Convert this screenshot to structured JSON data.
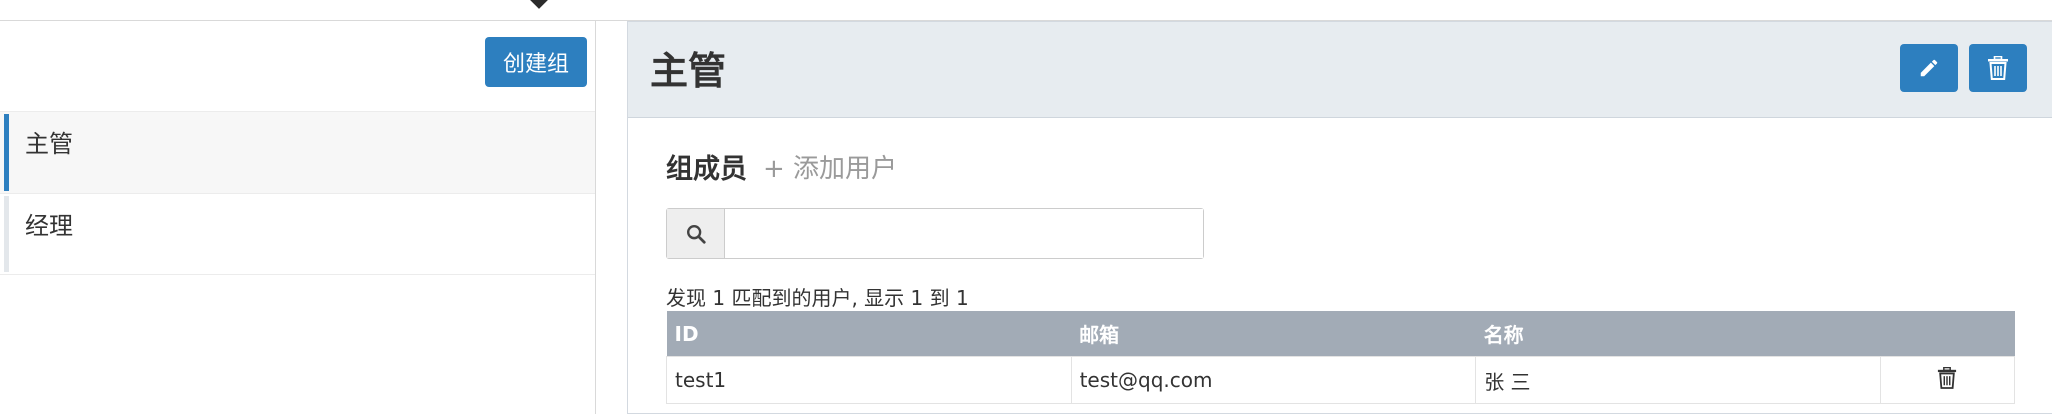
{
  "sidebar": {
    "create_button_label": "创建组",
    "groups": [
      {
        "label": "主管",
        "active": true
      },
      {
        "label": "经理",
        "active": false
      }
    ]
  },
  "main": {
    "title": "主管",
    "members_title": "组成员",
    "add_user_label": "+ 添加用户",
    "search": {
      "value": "",
      "placeholder": ""
    },
    "result_info": "发现 1 匹配到的用户, 显示 1 到 1",
    "table": {
      "columns": [
        "ID",
        "邮箱",
        "名称",
        ""
      ],
      "rows": [
        {
          "id": "test1",
          "email": "test@qq.com",
          "name": "张 三"
        }
      ]
    }
  },
  "icons": {
    "edit": "pencil-icon",
    "delete": "trash-icon",
    "search": "search-icon",
    "row_delete": "trash-icon"
  },
  "colors": {
    "primary": "#2d7fbf",
    "header_bg": "#e7ecf0",
    "table_header_bg": "#a2abb6",
    "muted_text": "#9a9a9a"
  }
}
